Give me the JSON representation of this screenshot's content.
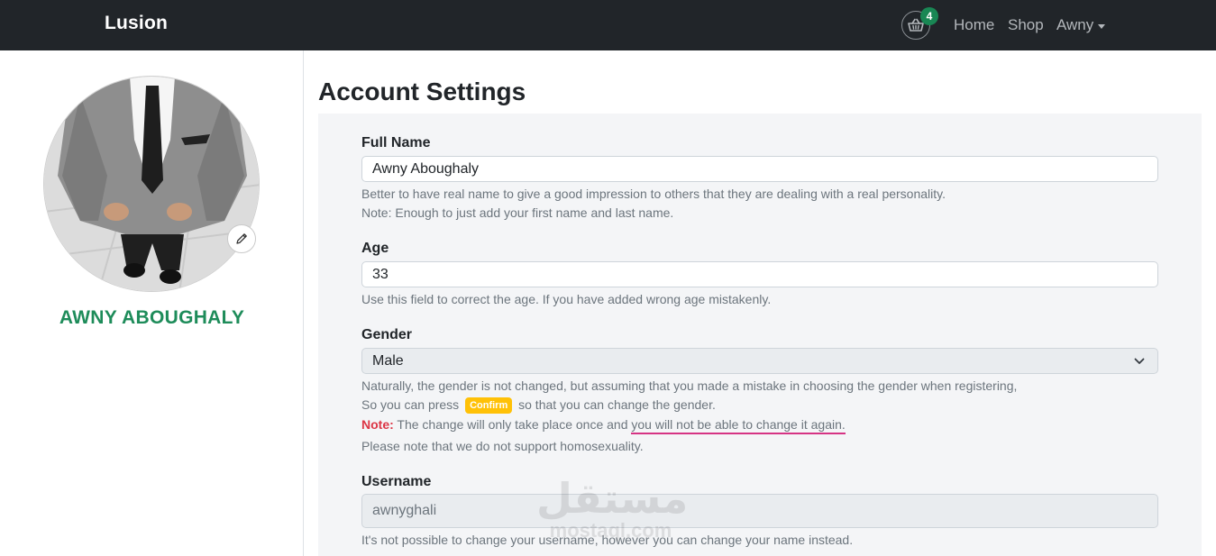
{
  "navbar": {
    "brand": "Lusion",
    "cart_count": "4",
    "links": {
      "home": "Home",
      "shop": "Shop",
      "user": "Awny"
    }
  },
  "profile": {
    "name": "AWNY ABOUGHALY"
  },
  "page": {
    "title": "Account Settings"
  },
  "form": {
    "full_name": {
      "label": "Full Name",
      "value": "Awny Aboughaly",
      "help_1": "Better to have real name to give a good impression to others that they are dealing with a real personality.",
      "help_2": "Note: Enough to just add your first name and last name."
    },
    "age": {
      "label": "Age",
      "value": "33",
      "help": "Use this field to correct the age. If you have added wrong age mistakenly."
    },
    "gender": {
      "label": "Gender",
      "selected": "Male",
      "help_1": "Naturally, the gender is not changed, but assuming that you made a mistake in choosing the gender when registering,",
      "help_2_before": "So you can press",
      "confirm_badge": "Confirm",
      "help_2_after": "so that you can change the gender.",
      "note_label": "Note:",
      "note_text": "The change will only take place once and",
      "note_underlined": "you will not be able to change it again.",
      "help_4": "Please note that we do not support homosexuality."
    },
    "username": {
      "label": "Username",
      "value": "awnyghali",
      "help": "It's not possible to change your username, however you can change your name instead."
    }
  },
  "watermark": {
    "arabic": "مستقل",
    "latin": "mostaql.com"
  },
  "colors": {
    "navbar_bg": "#212529",
    "badge_green": "#198754",
    "profile_name": "#1e8c5a",
    "confirm_badge": "#ffc107",
    "note_red": "#dc3545",
    "underline_pink": "#d63384",
    "panel_bg": "#f4f5f7"
  }
}
